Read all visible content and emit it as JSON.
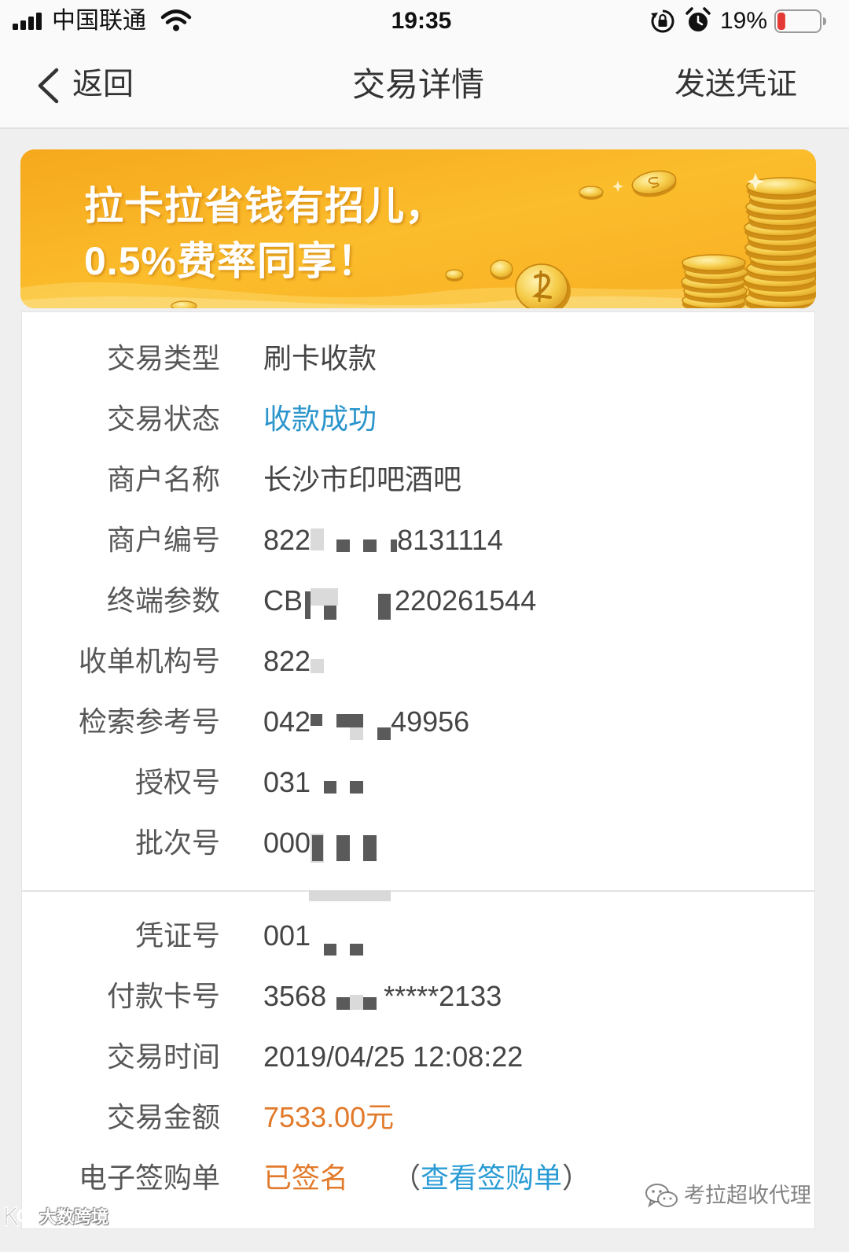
{
  "status_bar": {
    "carrier": "中国联通",
    "time": "19:35",
    "battery_text": "19%",
    "battery_level": 0.19
  },
  "nav": {
    "back_label": "返回",
    "title": "交易详情",
    "action_label": "发送凭证"
  },
  "banner": {
    "line1": "拉卡拉省钱有招儿，",
    "line2": "0.5%费率同享！"
  },
  "section1": [
    {
      "label": "交易类型",
      "value": "刷卡收款"
    },
    {
      "label": "交易状态",
      "value": "收款成功"
    },
    {
      "label": "商户名称",
      "value": "长沙市印吧酒吧"
    },
    {
      "label": "商户编号",
      "value_start": "822",
      "value_end": "8131114"
    },
    {
      "label": "终端参数",
      "value_start": "CB",
      "value_end": "220261544"
    },
    {
      "label": "收单机构号",
      "value_start": "822"
    },
    {
      "label": "检索参考号",
      "value_start": "042",
      "value_end": "49956"
    },
    {
      "label": "授权号",
      "value_start": "031"
    },
    {
      "label": "批次号",
      "value_start": "000"
    }
  ],
  "section2": [
    {
      "label": "凭证号",
      "value_start": "001"
    },
    {
      "label": "付款卡号",
      "value_start": "3568",
      "value_end": "*****2133"
    },
    {
      "label": "交易时间",
      "value": "2019/04/25 12:08:22"
    },
    {
      "label": "交易金额",
      "value": "7533.00元"
    },
    {
      "label": "电子签购单",
      "value": "已签名",
      "link_open": "（",
      "link_label": "查看签购单",
      "link_close": "）"
    }
  ],
  "watermarks": {
    "account": "考拉超收代理",
    "brand": "大数跨境"
  },
  "icons": {
    "signal": "signal-icon",
    "wifi": "wifi-icon",
    "rotation_lock": "rotation-lock-icon",
    "alarm": "alarm-icon",
    "battery": "battery-icon",
    "back": "chevron-left-icon",
    "wechat": "wechat-icon"
  },
  "colors": {
    "banner": "#f9b523",
    "success_blue": "#2b95cc",
    "link_blue": "#2a9bd4",
    "amount_orange": "#e27a2b",
    "label_gray": "#575757",
    "value_gray": "#454545",
    "battery_low_red": "#e53935"
  }
}
